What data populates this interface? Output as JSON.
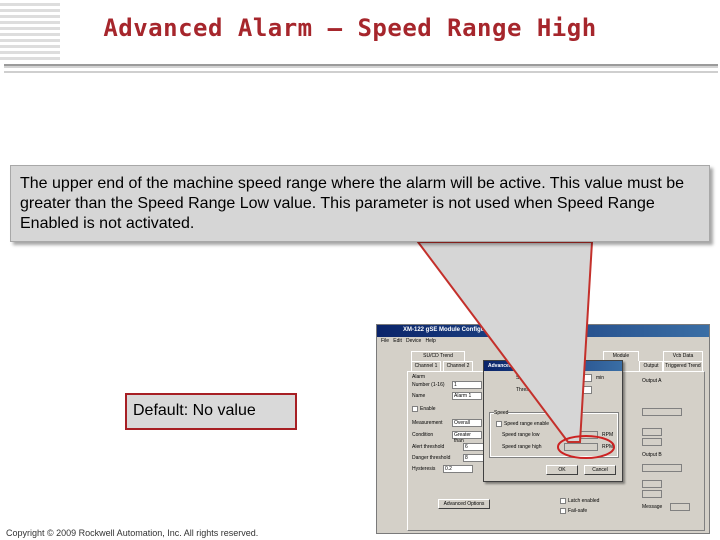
{
  "slide": {
    "title": "Advanced Alarm – Speed Range High",
    "callout_text": "The upper end of the machine speed range where the alarm will be active.  This value must be greater than the Speed Range Low value.  This parameter is not used when Speed Range Enabled is not activated.",
    "default_text": "Default:  No value",
    "copyright": "Copyright © 2009 Rockwell Automation, Inc. All rights reserved."
  },
  "colors": {
    "title": "#a6262c",
    "callout_bg": "#d6d6d6",
    "highlight_ellipse": "#cc2222",
    "arrow": "#c4302b",
    "titlebar": "#0a246a"
  },
  "config_window": {
    "title": "XM-122 gSE Module Configuration",
    "menu": [
      "File",
      "Edit",
      "Device",
      "Help"
    ],
    "tabs": [
      "SU/CD Trend",
      "Channel 1",
      "Channel 2",
      "Module",
      "Output",
      "Vcb Data",
      "Triggered Trend"
    ],
    "labels": {
      "alarm": "Alarm",
      "number": "Number (1-16)",
      "name": "Name",
      "enable": "Enable",
      "measurement": "Measurement",
      "condition": "Condition",
      "alert_threshold": "Alert threshold",
      "danger_threshold": "Danger threshold",
      "hysteresis": "Hysteresis",
      "advanced_button": "Advanced Options",
      "output_a": "Output A",
      "output_b": "Output B",
      "latch_enabled": "Latch enabled",
      "fail_safe": "Fail-safe",
      "message": "Message"
    },
    "values": {
      "number": "1",
      "name": "Alarm 1",
      "measurement": "Overall",
      "condition": "Greater than",
      "alert_threshold": "6",
      "danger_threshold": "8",
      "hysteresis": "0.2"
    }
  },
  "advanced_dialog": {
    "title": "Advanced Alarm",
    "labels": {
      "startup_period": "Startup period",
      "threshold_multiplier": "Threshold multiplier",
      "speed_group": "Speed",
      "speed_range_enable": "Speed range enable",
      "speed_range_low": "Speed range low",
      "speed_range_high": "Speed range high",
      "ok": "OK",
      "cancel": "Cancel"
    },
    "units": {
      "startup": "min",
      "low": "RPM",
      "high": "RPM"
    }
  }
}
